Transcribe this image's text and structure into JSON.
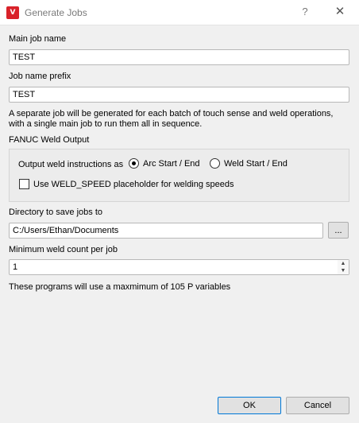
{
  "window": {
    "title": "Generate Jobs",
    "help_symbol": "?",
    "close_symbol": "✕",
    "logo_text": "V"
  },
  "main_job": {
    "label": "Main job name",
    "value": "TEST"
  },
  "prefix": {
    "label": "Job name prefix",
    "value": "TEST"
  },
  "description": [
    "A separate job will be generated for each batch of touch sense and weld operations,",
    "with a single main job to run them all in sequence."
  ],
  "weld_output": {
    "title": "FANUC Weld Output",
    "instructions_label": "Output weld instructions as",
    "options": [
      {
        "label": "Arc Start / End",
        "checked": true
      },
      {
        "label": "Weld Start / End",
        "checked": false
      }
    ],
    "weld_speed_label": "Use WELD_SPEED placeholder for welding speeds",
    "weld_speed_checked": false
  },
  "directory": {
    "label": "Directory to save jobs to",
    "value": "C:/Users/Ethan/Documents",
    "browse_label": "..."
  },
  "min_weld": {
    "label": "Minimum weld count per job",
    "value": "1",
    "up_symbol": "▲",
    "down_symbol": "▼"
  },
  "info_text": "These programs will use a maxmimum of 105 P variables",
  "buttons": {
    "ok": "OK",
    "cancel": "Cancel"
  }
}
